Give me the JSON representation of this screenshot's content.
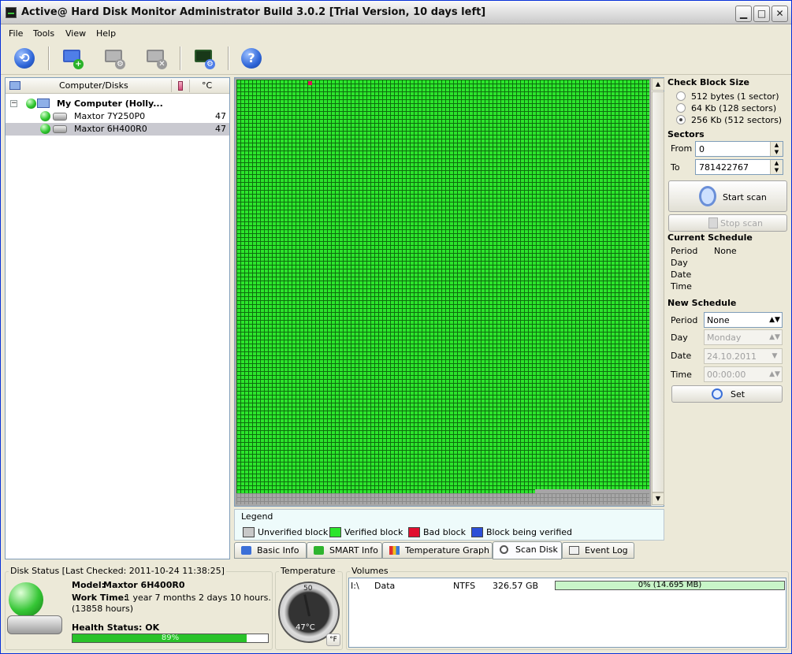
{
  "window": {
    "title": "Active@ Hard Disk Monitor Administrator Build 3.0.2 [Trial Version, 10 days left]",
    "min_symbol": "▁",
    "max_symbol": "□",
    "close_symbol": "✕"
  },
  "menu": [
    "File",
    "Tools",
    "View",
    "Help"
  ],
  "toolbar": [
    {
      "icon": "refresh-icon",
      "color": "#2f66d8"
    },
    {
      "icon": "add-computer-icon"
    },
    {
      "icon": "computer-settings-icon"
    },
    {
      "icon": "remove-computer-icon"
    },
    {
      "icon": "monitor-settings-icon"
    },
    {
      "icon": "help-icon",
      "symbol": "?",
      "color": "#2f66d8"
    }
  ],
  "tree": {
    "header_col1": "Computer/Disks",
    "header_col2": "°C",
    "computer": "My Computer (Holly...",
    "disks": [
      {
        "name": "Maxtor 7Y250P0",
        "temp": "47"
      },
      {
        "name": "Maxtor 6H400R0",
        "temp": "47"
      }
    ]
  },
  "legend": {
    "title": "Legend",
    "items": [
      {
        "label": "Unverified block",
        "color": "#c8c8c8"
      },
      {
        "label": "Verified block",
        "color": "#2ce52c"
      },
      {
        "label": "Bad block",
        "color": "#e01030"
      },
      {
        "label": "Block being verified",
        "color": "#2b4fd8"
      }
    ]
  },
  "tabs": [
    "Basic Info",
    "SMART Info",
    "Temperature Graph",
    "Scan Disk",
    "Event Log"
  ],
  "scan": {
    "check_block_size_title": "Check Block Size",
    "block_options": [
      "512 bytes (1 sector)",
      "64 Kb (128 sectors)",
      "256 Kb (512 sectors)"
    ],
    "selected_block_option": 2,
    "sectors_title": "Sectors",
    "from_label": "From",
    "from_value": "0",
    "to_label": "To",
    "to_value": "781422767",
    "start_scan": "Start scan",
    "stop_scan": "Stop scan"
  },
  "current_schedule": {
    "title": "Current Schedule",
    "period_label": "Period",
    "period_value": "None",
    "day_label": "Day",
    "date_label": "Date",
    "time_label": "Time"
  },
  "new_schedule": {
    "title": "New Schedule",
    "period_label": "Period",
    "period_value": "None",
    "day_label": "Day",
    "day_value": "Monday",
    "date_label": "Date",
    "date_value": "24.10.2011",
    "time_label": "Time",
    "time_value": "00:00:00",
    "set_label": "Set"
  },
  "disk_status": {
    "title": "Disk Status [Last Checked: 2011-10-24 11:38:25]",
    "model_label": "Model:",
    "model_value": "Maxtor 6H400R0",
    "work_time_label": "Work Time:",
    "work_time_value": "1 year 7 months 2 days 10 hours.",
    "work_time_hours": "(13858 hours)",
    "health_label": "Health Status: OK",
    "health_percent": "89%",
    "health_fraction": 0.89
  },
  "temperature": {
    "title": "Temperature",
    "value": "47°C",
    "scale_mid": "50",
    "unit_button": "°F"
  },
  "volumes": {
    "title": "Volumes",
    "rows": [
      {
        "drive": "I:\\",
        "label": "Data",
        "fs": "NTFS",
        "size": "326.57 GB",
        "usage": "0% (14.695 MB)",
        "fraction": 0.0
      }
    ]
  }
}
